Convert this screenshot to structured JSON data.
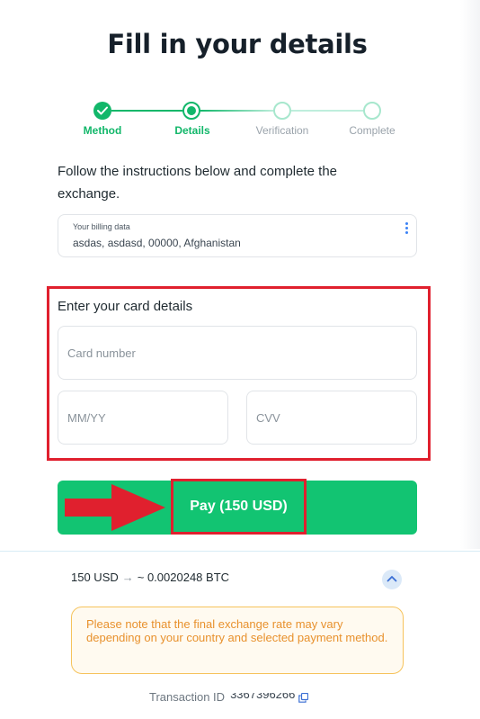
{
  "page": {
    "title": "Fill in your details"
  },
  "stepper": {
    "steps": [
      {
        "label": "Method",
        "state": "done"
      },
      {
        "label": "Details",
        "state": "current"
      },
      {
        "label": "Verification",
        "state": "todo"
      },
      {
        "label": "Complete",
        "state": "todo"
      }
    ]
  },
  "instructions": "Follow the instructions below and complete the exchange.",
  "billing": {
    "label": "Your billing data",
    "value": "asdas, asdasd, 00000, Afghanistan",
    "menu_icon": "kebab-menu-icon"
  },
  "card": {
    "title": "Enter your card details",
    "card_number_placeholder": "Card number",
    "expiry_placeholder": "MM/YY",
    "cvv_placeholder": "CVV"
  },
  "pay": {
    "label": "Pay (150 USD)",
    "arrow_icon": "red-arrow-icon"
  },
  "rate": {
    "from": "150 USD",
    "arrow": "→",
    "to": "~ 0.0020248 BTC",
    "collapse_icon": "chevron-up-icon"
  },
  "notice": "Please note that the final exchange rate may vary depending on your country and selected payment method.",
  "transaction": {
    "label": "Transaction ID",
    "value": "3367396266",
    "copy_icon": "copy-icon"
  },
  "colors": {
    "accent": "#12b76a",
    "pay_button": "#12c472",
    "highlight": "#e0202e",
    "notice_text": "#e8912d"
  }
}
